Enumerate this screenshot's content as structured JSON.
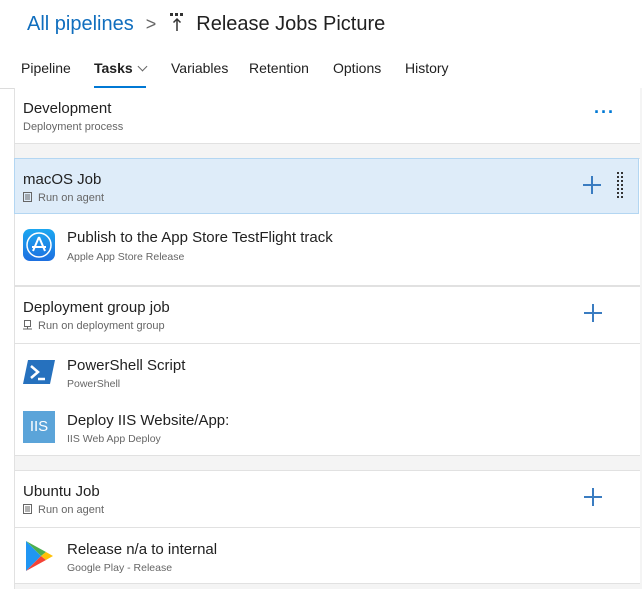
{
  "breadcrumb": {
    "root_label": "All pipelines",
    "separator": ">",
    "pipeline_title": "Release Jobs Picture"
  },
  "tabs": [
    {
      "label": "Pipeline"
    },
    {
      "label": "Tasks"
    },
    {
      "label": "Variables"
    },
    {
      "label": "Retention"
    },
    {
      "label": "Options"
    },
    {
      "label": "History"
    }
  ],
  "active_tab": "Tasks",
  "stage": {
    "title": "Development",
    "subtitle": "Deployment process",
    "menu_glyph": "···"
  },
  "jobs": [
    {
      "title": "macOS Job",
      "subtitle": "Run on agent",
      "selected": true,
      "tasks": [
        {
          "title": "Publish to the App Store TestFlight track",
          "subtitle": "Apple App Store Release",
          "icon": "app-store-icon"
        }
      ]
    },
    {
      "title": "Deployment group job",
      "subtitle": "Run on deployment group",
      "selected": false,
      "tasks": [
        {
          "title": "PowerShell Script",
          "subtitle": "PowerShell",
          "icon": "powershell-icon"
        },
        {
          "title": "Deploy IIS Website/App:",
          "subtitle": "IIS Web App Deploy",
          "icon": "iis-icon",
          "icon_text": "IIS"
        }
      ]
    },
    {
      "title": "Ubuntu Job",
      "subtitle": "Run on agent",
      "selected": false,
      "tasks": [
        {
          "title": "Release n/a to internal",
          "subtitle": "Google Play - Release",
          "icon": "google-play-icon"
        }
      ]
    }
  ],
  "colors": {
    "accent": "#0078d4",
    "link": "#106ebe",
    "selected_bg": "#deecf9",
    "panel_bg": "#f4f4f4"
  }
}
